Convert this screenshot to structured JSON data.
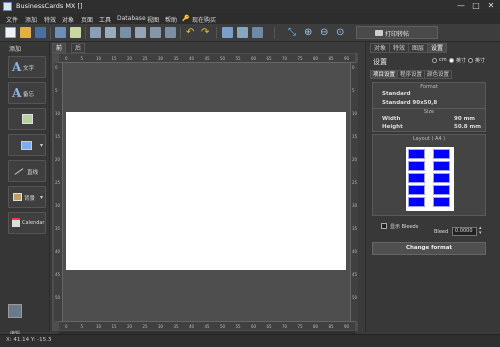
{
  "window": {
    "title": "BusinessCards MX []",
    "minimize": "—",
    "maximize": "□",
    "close": "✕"
  },
  "menu": [
    "文件",
    "添加",
    "特效",
    "对象",
    "页面",
    "工具",
    "Database",
    "视图",
    "帮助",
    "🔑",
    "现在购买"
  ],
  "toolbar": {
    "print_label": "打印转帖"
  },
  "left_panel": {
    "title": "添加",
    "items": [
      {
        "icon": "text-icon",
        "glyph": "A",
        "label": "文字"
      },
      {
        "icon": "memo-icon",
        "glyph": "A",
        "label": "备忘"
      },
      {
        "icon": "image-icon",
        "glyph": "",
        "label": ""
      },
      {
        "icon": "shape-icon",
        "glyph": "",
        "label": ""
      },
      {
        "icon": "line-icon",
        "glyph": "",
        "label": "直线"
      },
      {
        "icon": "background-icon",
        "glyph": "",
        "label": "背景"
      },
      {
        "icon": "calendar-icon",
        "glyph": "",
        "label": "Calendar"
      }
    ],
    "bottom_label": "编辑"
  },
  "doc_tabs": [
    "前面",
    "后面"
  ],
  "ruler": {
    "top": [
      "0",
      "5",
      "10",
      "15",
      "20",
      "25",
      "30",
      "35",
      "40",
      "45",
      "50",
      "55",
      "60",
      "65",
      "70",
      "75",
      "80",
      "85",
      "90"
    ],
    "bottom": [
      "0",
      "5",
      "10",
      "15",
      "20",
      "25",
      "30",
      "35",
      "40",
      "45",
      "50",
      "55",
      "60",
      "65",
      "70",
      "75",
      "80",
      "85",
      "90"
    ],
    "left": [
      "0",
      "5",
      "10",
      "15",
      "20",
      "25",
      "30",
      "35",
      "40",
      "45",
      "50"
    ],
    "right": [
      "0",
      "5",
      "10",
      "15",
      "20",
      "25",
      "30",
      "35",
      "40",
      "45",
      "50"
    ]
  },
  "right_panel": {
    "tabs": [
      "对象",
      "特效",
      "图层",
      "设置"
    ],
    "active_tab": "设置",
    "settings_title": "设置",
    "units": [
      "cm",
      "英寸",
      "英寸"
    ],
    "subtabs": [
      "项目设置",
      "程序设置",
      "颜色设置"
    ],
    "format_group": {
      "title": "Format",
      "format_type": "Standard",
      "format_name": "Standard 90x50,8"
    },
    "size_group": {
      "title": "Size",
      "width_label": "Width",
      "width_value": "90 mm",
      "height_label": "Height",
      "height_value": "50.8 mm"
    },
    "layout_group": {
      "title": "Layout ( A4 )"
    },
    "show_bleeds_label": "显示 Bleeds",
    "bleed_label": "Bleed",
    "bleed_value": "0.0000",
    "change_format_label": "Change format"
  },
  "status": {
    "coords": "X: 41.14  Y: -15.3"
  },
  "colors": {
    "layout_cell": "#0000ff",
    "canvas": "#ffffff",
    "workspace": "#4e4e4e"
  }
}
